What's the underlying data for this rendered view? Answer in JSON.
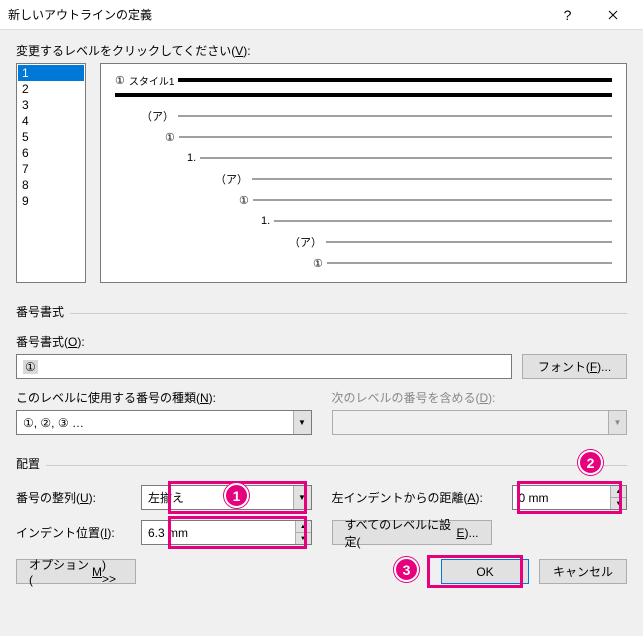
{
  "title": "新しいアウトラインの定義",
  "level_prompt_pre": "変更するレベルをクリックしてください(",
  "level_prompt_key": "V",
  "level_prompt_post": "):",
  "levels": [
    "1",
    "2",
    "3",
    "4",
    "5",
    "6",
    "7",
    "8",
    "9"
  ],
  "preview": {
    "style_label": "スタイル1",
    "rows": [
      {
        "indent": 0,
        "label": "①",
        "dark": true,
        "style": true
      },
      {
        "indent": 0,
        "label": "",
        "dark": true,
        "extra": true
      },
      {
        "indent": 26,
        "label": "（ア）"
      },
      {
        "indent": 50,
        "label": "①"
      },
      {
        "indent": 72,
        "label": "1."
      },
      {
        "indent": 100,
        "label": "（ア）"
      },
      {
        "indent": 124,
        "label": "①"
      },
      {
        "indent": 146,
        "label": "1."
      },
      {
        "indent": 174,
        "label": "（ア）"
      },
      {
        "indent": 198,
        "label": "①"
      }
    ]
  },
  "group_format": "番号書式",
  "format_label_pre": "番号書式(",
  "format_label_key": "O",
  "format_label_post": "):",
  "format_value": "①",
  "font_btn_pre": "フォント(",
  "font_btn_key": "F",
  "font_btn_post": ")...",
  "number_type_label_pre": "このレベルに使用する番号の種類(",
  "number_type_label_key": "N",
  "number_type_label_post": "):",
  "number_type_value": "①, ②, ③ …",
  "include_prev_label_pre": "次のレベルの番号を含める(",
  "include_prev_label_key": "D",
  "include_prev_label_post": "):",
  "group_position": "配置",
  "align_label_pre": "番号の整列(",
  "align_label_key": "U",
  "align_label_post": "):",
  "align_value": "左揃え",
  "left_indent_label_pre": "左インデントからの距離(",
  "left_indent_label_key": "A",
  "left_indent_label_post": "):",
  "left_indent_value": "0 mm",
  "indent_pos_label_pre": "インデント位置(",
  "indent_pos_label_key": "I",
  "indent_pos_label_post": "):",
  "indent_pos_value": "6.3 mm",
  "set_all_btn_pre": "すべてのレベルに設定(",
  "set_all_btn_key": "E",
  "set_all_btn_post": ")...",
  "options_btn_pre": "オプション(",
  "options_btn_key": "M",
  "options_btn_post": ") >>",
  "ok_btn": "OK",
  "cancel_btn": "キャンセル",
  "callouts": {
    "c1": "1",
    "c2": "2",
    "c3": "3"
  }
}
